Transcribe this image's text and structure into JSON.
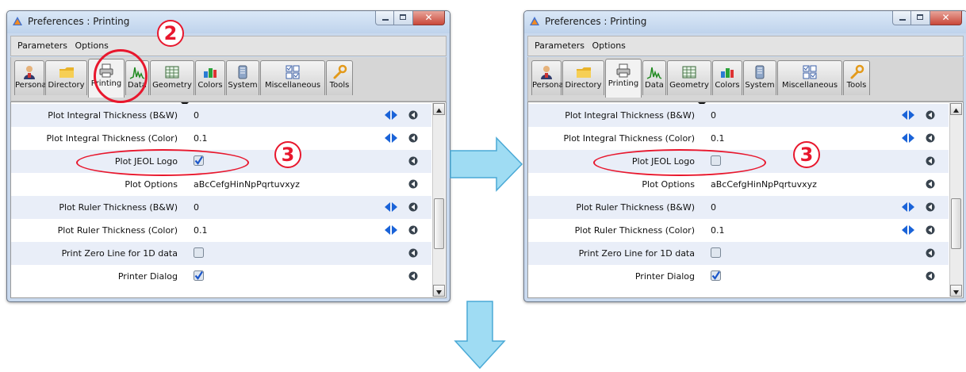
{
  "windows": [
    {
      "title": "Preferences : Printing",
      "menu": [
        "Parameters",
        "Options"
      ],
      "tabs": [
        "Personal",
        "Directory",
        "Printing",
        "Data",
        "Geometry",
        "Colors",
        "System",
        "Miscellaneous",
        "Tools"
      ],
      "active_tab": "Printing",
      "rows": [
        {
          "label": "Plot Integral Thickness (B&W)",
          "value": "0"
        },
        {
          "label": "Plot Integral Thickness (Color)",
          "value": "0.1"
        },
        {
          "label": "Plot JEOL Logo",
          "checked": true
        },
        {
          "label": "Plot Options",
          "value": "aBcCefgHinNpPqrtuvxyz"
        },
        {
          "label": "Plot Ruler Thickness (B&W)",
          "value": "0"
        },
        {
          "label": "Plot Ruler Thickness (Color)",
          "value": "0.1"
        },
        {
          "label": "Print Zero Line for 1D data",
          "checked": false
        },
        {
          "label": "Printer Dialog",
          "checked": true
        }
      ]
    },
    {
      "title": "Preferences : Printing",
      "menu": [
        "Parameters",
        "Options"
      ],
      "tabs": [
        "Personal",
        "Directory",
        "Printing",
        "Data",
        "Geometry",
        "Colors",
        "System",
        "Miscellaneous",
        "Tools"
      ],
      "active_tab": "Printing",
      "rows": [
        {
          "label": "Plot Integral Thickness (B&W)",
          "value": "0"
        },
        {
          "label": "Plot Integral Thickness (Color)",
          "value": "0.1"
        },
        {
          "label": "Plot JEOL Logo",
          "checked": false
        },
        {
          "label": "Plot Options",
          "value": "aBcCefgHinNpPqrtuvxyz"
        },
        {
          "label": "Plot Ruler Thickness (B&W)",
          "value": "0"
        },
        {
          "label": "Plot Ruler Thickness (Color)",
          "value": "0.1"
        },
        {
          "label": "Print Zero Line for 1D data",
          "checked": false
        },
        {
          "label": "Printer Dialog",
          "checked": true
        }
      ]
    }
  ],
  "annotations": {
    "step2": "2",
    "step3": "3",
    "color": "#e8172d",
    "arrow_color": "#9fdcf3"
  },
  "icons": {
    "tabs": [
      "person-icon",
      "folder-icon",
      "printer-icon",
      "chart-icon",
      "grid-icon",
      "colors-icon",
      "system-icon",
      "checklist-icon",
      "wrench-icon"
    ],
    "row_controls": [
      "left-right-arrows-icon",
      "reset-icon"
    ]
  }
}
